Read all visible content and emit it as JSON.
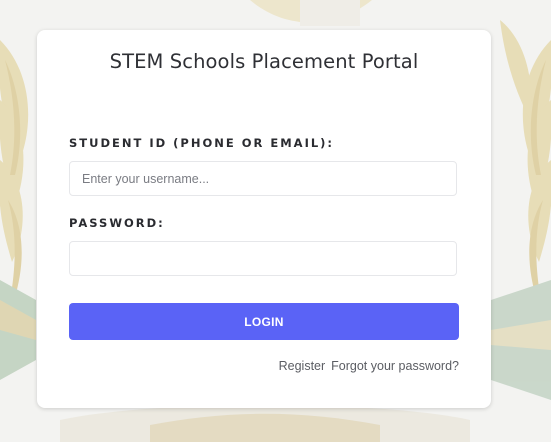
{
  "page": {
    "title": "STEM Schools Placement Portal"
  },
  "form": {
    "username_label": "STUDENT ID (PHONE OR EMAIL):",
    "username_placeholder": "Enter your username...",
    "username_value": "",
    "password_label": "PASSWORD:",
    "password_value": "",
    "login_label": "LOGIN"
  },
  "links": {
    "register": "Register",
    "forgot_password": "Forgot your password?"
  },
  "colors": {
    "accent": "#5a63f6",
    "background": "#f3f3f1",
    "card": "#ffffff",
    "emblem_gold": "#d8bb55"
  },
  "icons": {
    "background": "coat-of-arms-watermark"
  }
}
